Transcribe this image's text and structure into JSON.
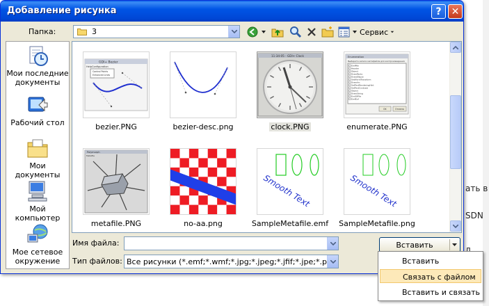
{
  "background": {
    "fragments": [
      "ать в о",
      "SDN",
      "л"
    ]
  },
  "dialog": {
    "title": "Добавление рисунка",
    "help_label": "?",
    "close_label": "✕"
  },
  "folder": {
    "label": "Папка:",
    "value": "3"
  },
  "toolbar": {
    "service_label": "Сервис"
  },
  "places": [
    {
      "label": "Мои последние документы",
      "icon": "recent-docs-icon"
    },
    {
      "label": "Рабочий стол",
      "icon": "desktop-icon"
    },
    {
      "label": "Мои документы",
      "icon": "my-documents-icon"
    },
    {
      "label": "Мой компьютер",
      "icon": "my-computer-icon"
    },
    {
      "label": "Мое сетевое окружение",
      "icon": "network-icon"
    }
  ],
  "files": [
    {
      "name": "bezier.PNG"
    },
    {
      "name": "bezier-desc.png"
    },
    {
      "name": "clock.PNG",
      "selected": true
    },
    {
      "name": "enumerate.PNG"
    },
    {
      "name": "metafile.PNG"
    },
    {
      "name": "no-aa.png"
    },
    {
      "name": "SampleMetafile.emf"
    },
    {
      "name": "SampleMetafile.png"
    }
  ],
  "thumb_text": {
    "bezier_title": "GDI+ Bezier",
    "bezier_menu": [
      "Help",
      "Configuration"
    ],
    "bezier_menu_items": [
      "Control Points",
      "Enhanced Lines"
    ],
    "clock_title": "11:34:05 - GDI+ Clock",
    "enumerate_title": "Enumeration",
    "enumerate_heading": "Выберите записи метафайла для воспроизведения",
    "enumerate_records": [
      "EmfMin",
      "Header",
      "Object",
      "DrawRects",
      "DrawEllipse",
      "SetWorldTransform",
      "DrawArc",
      "SetTextRenderingHint",
      "SetTextContrast",
      "Object",
      "DrawString",
      "EndOfFile",
      "EmfEof"
    ],
    "enumerate_buttons": [
      "OK",
      "Отмена"
    ],
    "metafile_title": "Polymorph",
    "metafile_menu": "Metafile",
    "smooth_text": "Smooth Text"
  },
  "filename": {
    "label": "Имя файла:",
    "value": ""
  },
  "filetype": {
    "label": "Тип файлов:",
    "value": "Все рисунки (*.emf;*.wmf;*.jpg;*.jpeg;*.jfif;*.jpe;*.png;"
  },
  "insert_button": {
    "label": "Вставить"
  },
  "insert_menu": [
    {
      "label": "Вставить"
    },
    {
      "label": "Связать с файлом",
      "highlighted": true
    },
    {
      "label": "Вставить и связать"
    }
  ],
  "colors": {
    "title_bar": "#0054e3",
    "dialog_bg": "#ece9d8",
    "menu_highlight": "#fde9b9",
    "checker_red": "#ee1c24",
    "band_blue": "#1f3fe8",
    "ellipse_green": "#22cc22"
  }
}
